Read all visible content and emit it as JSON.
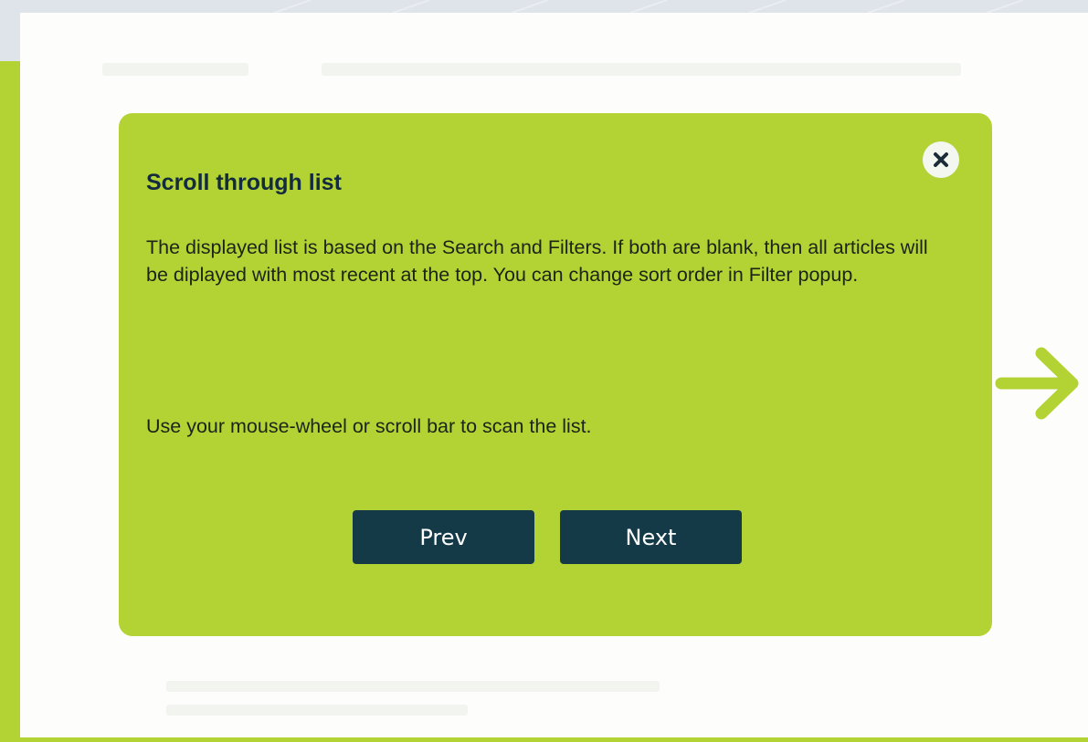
{
  "colors": {
    "accent_green": "#b3d334",
    "button_navy": "#143a48",
    "title_navy": "#132b3e",
    "panel_white": "#fdfefc",
    "background_gray": "#dfe4ea"
  },
  "tour_popup": {
    "title": "Scroll through list",
    "body_paragraph_1": "The displayed list is based on the Search and Filters.  If both are blank, then all articles will be diplayed with most recent at the top.   You can change sort order in Filter popup.",
    "body_paragraph_2": "Use your mouse-wheel or scroll bar to scan the list.",
    "close_icon": "close-icon",
    "prev_label": "Prev",
    "next_label": "Next"
  },
  "pointer": {
    "icon": "arrow-right-icon"
  }
}
